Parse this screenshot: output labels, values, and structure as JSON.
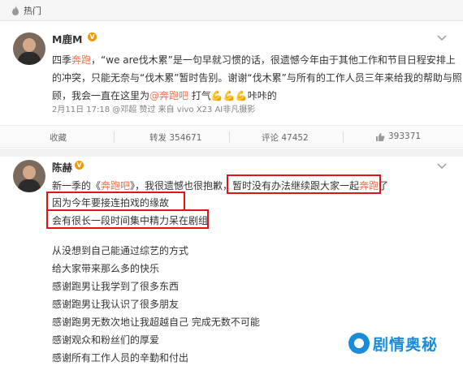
{
  "hot_bar": {
    "label": "热门"
  },
  "post1": {
    "username": "M鹿M",
    "text_line1_a": "四季",
    "text_line1_link": "奔跑",
    "text_line1_b": "，“we are伐木累”是一句早就习惯的话，很遗憾今年由于其他工作和节目日程安排上",
    "text_line2": "的冲突，只能无奈与“伐木累”暂时告别。谢谢“伐木累”与所有的工作人员三年来给我的帮助与照",
    "text_line3_a": "顾，我会一直在这里为",
    "text_line3_link": "@奔跑吧",
    "text_line3_b": " 打气",
    "text_line3_c": "咔咔的",
    "meta": "2月11日 17:18 @邓超 赞过 来自 vivo X23 AI非凡摄影",
    "actions": {
      "favorite": "收藏",
      "repost": "转发 354671",
      "comment": "评论 47452",
      "like": "393371"
    }
  },
  "post2": {
    "username": "陈赫",
    "line1_a": "新一季的《",
    "line1_link": "奔跑吧",
    "line1_b": "》，我很遗憾也很抱歉，",
    "line1_c": "暂时没有办法继续跟大家一起",
    "line1_link2": "奔跑",
    "line1_d": "了",
    "line2": "因为今年要接连拍戏的缘故",
    "line3": "会有很长一段时间集中精力呆在剧组",
    "lines": [
      "从没想到自己能通过综艺的方式",
      "给大家带来那么多的快乐",
      "感谢跑男让我学到了很多东西",
      "感谢跑男让我认识了很多朋友",
      "感谢跑男无数次地让我超越自己 完成无数不可能",
      "感谢观众和粉丝们的厚爱",
      "感谢所有工作人员的辛勤和付出"
    ]
  },
  "watermark": {
    "text": "剧情奥秘"
  },
  "colors": {
    "link": "#eb7350",
    "highlight_box": "#e0131a",
    "watermark": "#1b8cd8",
    "vip_badge": "#f39800"
  }
}
